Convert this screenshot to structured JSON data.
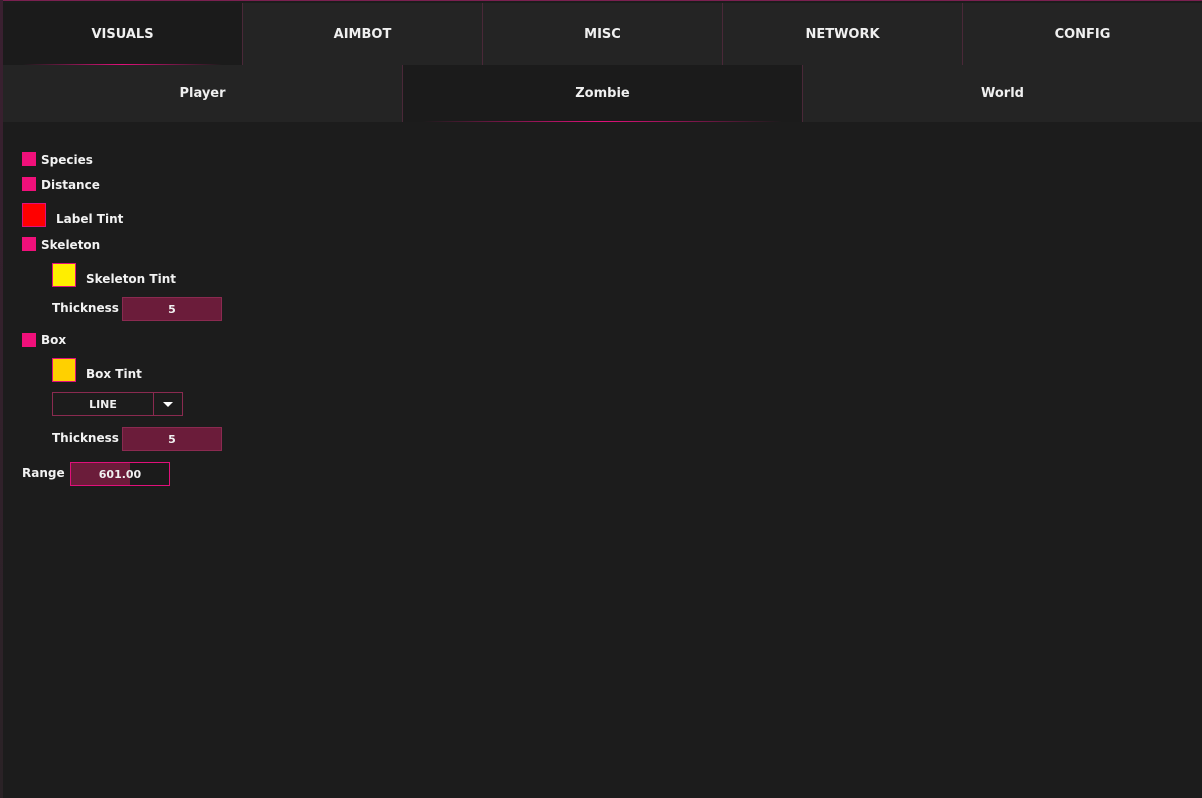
{
  "main_tabs": [
    {
      "label": "VISUALS",
      "active": true
    },
    {
      "label": "AIMBOT",
      "active": false
    },
    {
      "label": "MISC",
      "active": false
    },
    {
      "label": "NETWORK",
      "active": false
    },
    {
      "label": "CONFIG",
      "active": false
    }
  ],
  "sub_tabs": [
    {
      "label": "Player",
      "active": false
    },
    {
      "label": "Zombie",
      "active": true
    },
    {
      "label": "World",
      "active": false
    }
  ],
  "options": {
    "species": {
      "label": "Species",
      "checked": true
    },
    "distance": {
      "label": "Distance",
      "checked": true
    },
    "label_tint": {
      "label": "Label Tint",
      "color": "#ff0000"
    },
    "skeleton": {
      "label": "Skeleton",
      "checked": true
    },
    "skeleton_tint": {
      "label": "Skeleton Tint",
      "color": "#ffee00"
    },
    "skeleton_thickness": {
      "label": "Thickness",
      "value": "5"
    },
    "box": {
      "label": "Box",
      "checked": true
    },
    "box_tint": {
      "label": "Box Tint",
      "color": "#ffd000"
    },
    "box_style": {
      "selected": "LINE",
      "arrow_icon": "chevron-down-icon"
    },
    "box_thickness": {
      "label": "Thickness",
      "value": "5"
    },
    "range": {
      "label": "Range",
      "value": "601.00",
      "fill_fraction": 0.6
    }
  },
  "colors": {
    "accent": "#f0107a",
    "background": "#1c1c1c",
    "slider": "#6b1c3a"
  }
}
